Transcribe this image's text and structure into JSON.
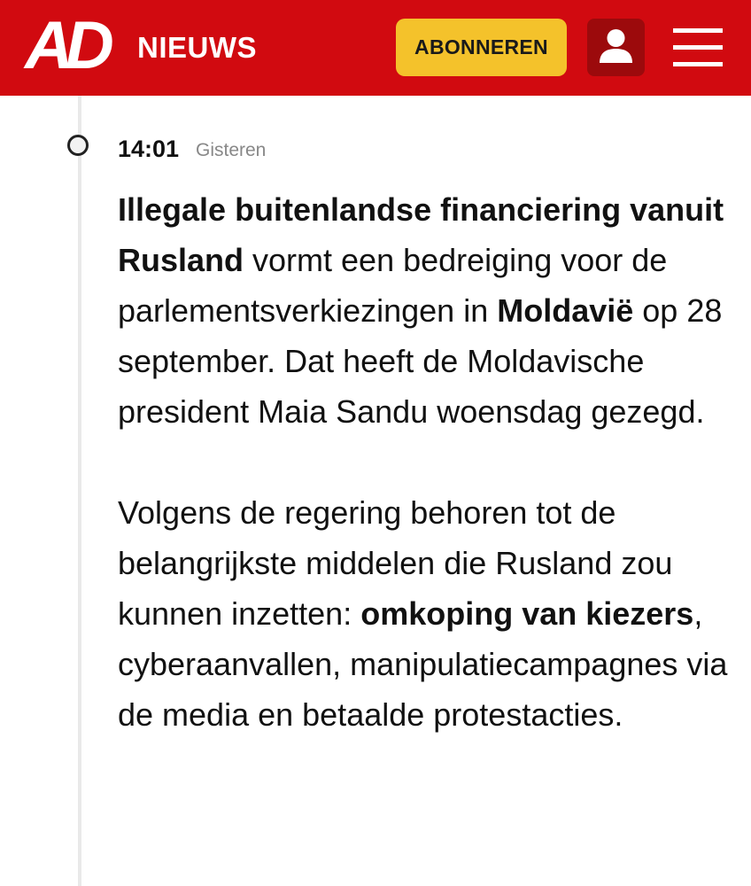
{
  "header": {
    "logo": "AD",
    "section": "NIEUWS",
    "subscribe_label": "ABONNEREN"
  },
  "post": {
    "time": "14:01",
    "day": "Gisteren",
    "p1": {
      "b1": "Illegale buitenlandse financiering vanuit Rusland",
      "t1": " vormt een bedreiging voor de parlementsverkiezingen in ",
      "b2": "Moldavië",
      "t2": " op 28 september. Dat heeft de Moldavische president Maia Sandu woensdag gezegd."
    },
    "p2": {
      "t1": "Volgens de regering behoren tot de belangrijkste middelen die Rusland zou kunnen inzetten: ",
      "b1": "omkoping van kiezers",
      "t2": ", cyberaanvallen, manipulatiecampagnes via de media en betaalde protestacties."
    }
  },
  "colors": {
    "header_red": "#d10a10",
    "subscribe_yellow": "#f4c22b",
    "account_dark_red": "#9c0a0c"
  },
  "icons": {
    "account": "user-icon",
    "menu": "hamburger-icon"
  }
}
